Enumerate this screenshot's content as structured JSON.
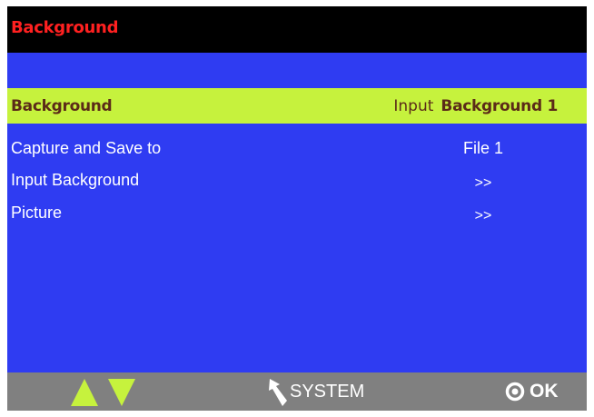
{
  "title": "Background",
  "selected_row": {
    "label": "Background",
    "value_prefix": "Input",
    "value": "Background 1"
  },
  "menu": [
    {
      "label": "Capture and Save to",
      "value": "File 1"
    },
    {
      "label": "Input Background",
      "value": ">>"
    },
    {
      "label": "Picture",
      "value": ">>"
    }
  ],
  "footer": {
    "up_icon": "triangle-up-icon",
    "down_icon": "triangle-down-icon",
    "back_icon": "back-arrow-icon",
    "system_label": "SYSTEM",
    "ok_icon": "ok-circle-icon",
    "ok_label": "OK"
  },
  "colors": {
    "background": "#2f3cf2",
    "title_bar": "#000000",
    "title_text": "#ff2020",
    "highlight": "#c6f23d",
    "highlight_text": "#5b2b18",
    "footer": "#808080",
    "text": "#ffffff"
  }
}
